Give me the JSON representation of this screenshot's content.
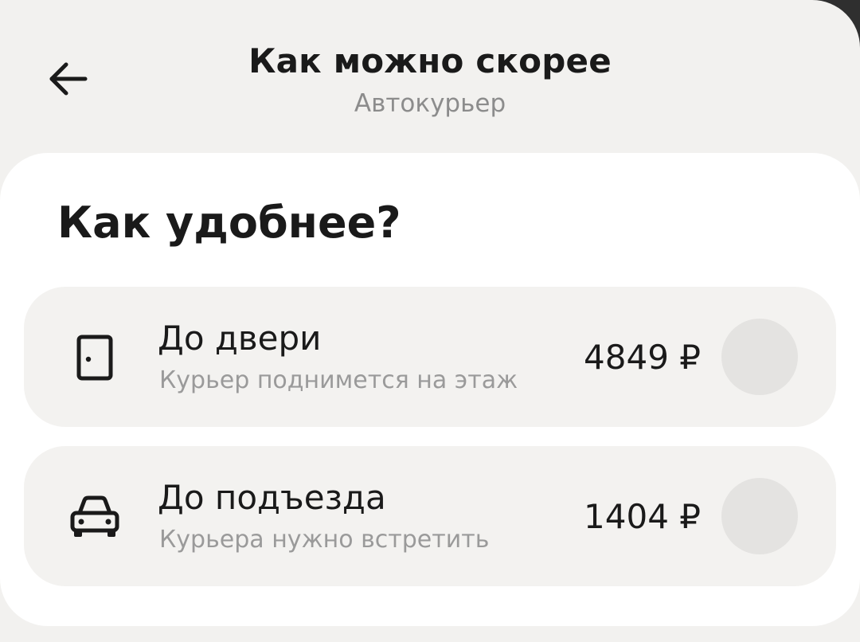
{
  "header": {
    "title": "Как можно скорее",
    "subtitle": "Автокурьер"
  },
  "sheet": {
    "title": "Как удобнее?",
    "options": [
      {
        "icon": "door-icon",
        "label": "До двери",
        "description": "Курьер поднимется на этаж",
        "price": "4849 ₽",
        "selected": false
      },
      {
        "icon": "car-icon",
        "label": "До подъезда",
        "description": "Курьера нужно встретить",
        "price": "1404 ₽",
        "selected": false
      }
    ]
  },
  "colors": {
    "background": "#f2f1ef",
    "card": "#ffffff",
    "option_bg": "#f3f2f0",
    "radio_bg": "#e4e3e1",
    "text_primary": "#1a1a1a",
    "text_secondary": "#8c8c8c"
  }
}
